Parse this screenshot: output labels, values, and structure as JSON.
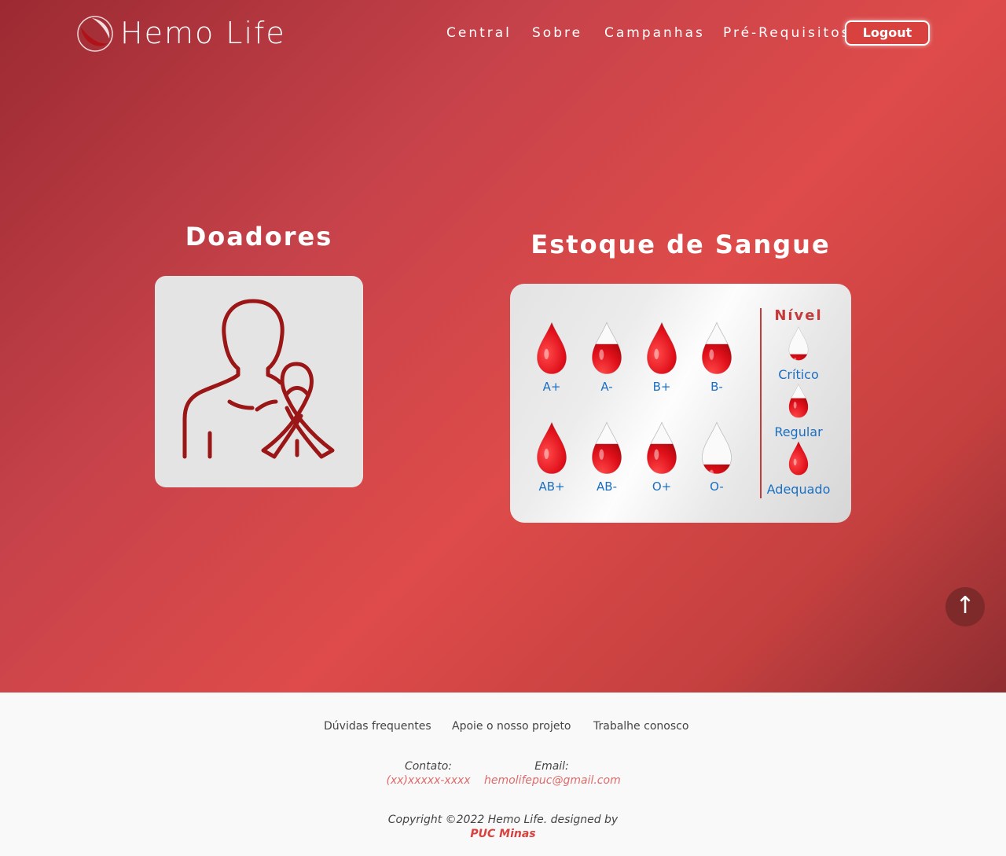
{
  "header": {
    "brand": "Hemo Life",
    "nav": [
      "Central",
      "Sobre",
      "Campanhas",
      "Pré-Requisitos"
    ],
    "logout": "Logout"
  },
  "donors": {
    "title": "Doadores"
  },
  "stock": {
    "title": "Estoque de Sangue",
    "types": [
      {
        "label": "A+",
        "level": "adequado"
      },
      {
        "label": "A-",
        "level": "regular"
      },
      {
        "label": "B+",
        "level": "adequado"
      },
      {
        "label": "B-",
        "level": "regular"
      },
      {
        "label": "AB+",
        "level": "adequado"
      },
      {
        "label": "AB-",
        "level": "regular"
      },
      {
        "label": "O+",
        "level": "regular"
      },
      {
        "label": "O-",
        "level": "critico"
      }
    ],
    "legend": {
      "title": "Nível",
      "items": [
        {
          "label": "Crítico",
          "level": "critico"
        },
        {
          "label": "Regular",
          "level": "regular"
        },
        {
          "label": "Adequado",
          "level": "adequado"
        }
      ]
    }
  },
  "scroll_top": "↑",
  "footer": {
    "links": [
      "Dúvidas frequentes",
      "Apoie o nosso projeto",
      "Trabalhe conosco"
    ],
    "contact_label": "Contato:",
    "contact_value": "(xx)xxxxx-xxxx",
    "email_label": "Email:",
    "email_value": "hemolifepuc@gmail.com",
    "copyright": "Copyright ©2022 Hemo Life. designed by",
    "designer": "PUC Minas"
  },
  "colors": {
    "accent": "#d9413f",
    "link_blue": "#1a6fc2",
    "icon_red": "#9b1616"
  }
}
